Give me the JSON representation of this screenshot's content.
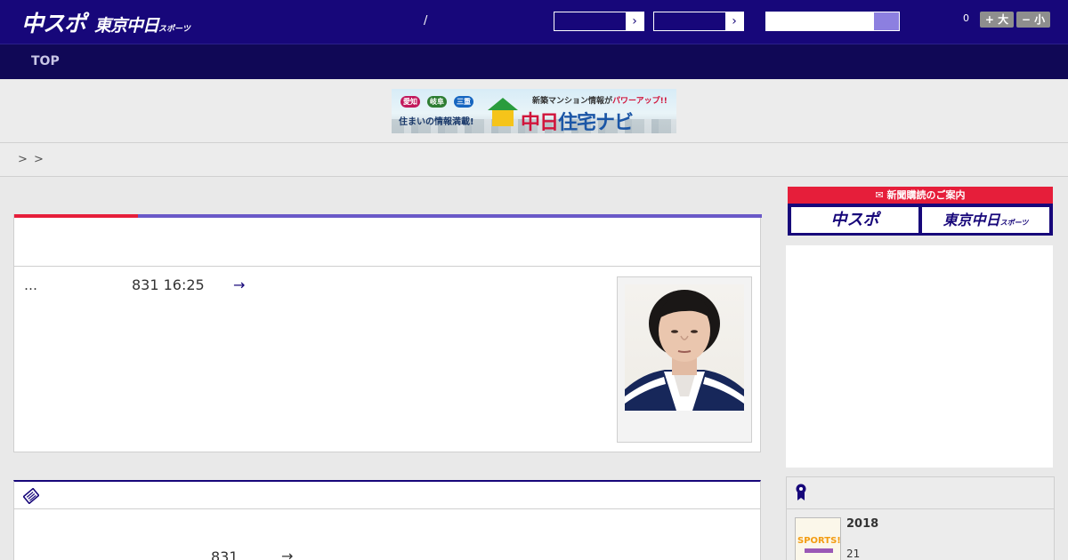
{
  "header": {
    "logo_chuspo": "中スポ",
    "logo_tokyo": "東京中日",
    "logo_sports_small": "スポーツ",
    "slash": "/",
    "count": "0",
    "font_larger": "+ 大",
    "font_smaller": "− 小"
  },
  "nav": {
    "top_label": "TOP"
  },
  "banner": {
    "tag1": "愛知",
    "tag2": "岐阜",
    "tag3": "三重",
    "line1": "住まいの情報満載!",
    "line2a": "新築マンション情報が",
    "line2b": "パワーアップ!!",
    "main_a": "中日",
    "main_b": "住宅ナビ"
  },
  "breadcrumb": {
    "sep1": ">",
    "sep2": ">"
  },
  "article": {
    "ellipsis": "…",
    "date": "831 16:25",
    "arrow": "→"
  },
  "card2": {
    "date": "831",
    "arrow": "→"
  },
  "sidebar": {
    "subscription_header": "新聞購読のご案内",
    "btn_chuspo": "中スポ",
    "btn_tokyo": "東京中日",
    "btn_tokyo_small": "スポーツ",
    "year": "2018",
    "number": "21",
    "thumb_text": "SPORTS!!"
  },
  "colors": {
    "header_bg": "#17077a",
    "nav_bg": "#100856",
    "accent_red": "#e61e3a",
    "accent_purple": "#6a59c8",
    "search_button": "#8c7fe0"
  }
}
